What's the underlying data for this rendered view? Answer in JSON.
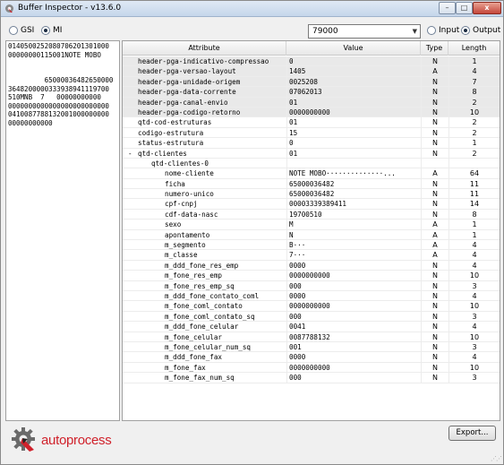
{
  "window": {
    "title": "Buffer Inspector - v13.6.0",
    "min_label": "–",
    "max_label": "□",
    "close_label": "x"
  },
  "toolbar": {
    "gsi_label": "GSI",
    "mi_label": "MI",
    "selected_mode": "MI",
    "combo_value": "79000",
    "input_label": "Input",
    "output_label": "Output",
    "selected_io": "Output"
  },
  "raw_buffer": "0140500252080706201301000\n00000000115001NOTE MOBO\n\n\n         65000036482650000\n3648200000333938941119700\n510MNB  7   00000000000\n0000000000000000000000000\n0410087788132001000000000\n00000000000",
  "grid": {
    "columns": [
      "Attribute",
      "Value",
      "Type",
      "Length"
    ],
    "rows": [
      {
        "attr": "header-pga-indicativo-compressao",
        "value": "0",
        "type": "N",
        "length": "1",
        "indent": 0,
        "hl": true
      },
      {
        "attr": "header-pga-versao-layout",
        "value": "1405",
        "type": "A",
        "length": "4",
        "indent": 0,
        "hl": true
      },
      {
        "attr": "header-pga-unidade-origem",
        "value": "0025208",
        "type": "N",
        "length": "7",
        "indent": 0,
        "hl": true
      },
      {
        "attr": "header-pga-data-corrente",
        "value": "07062013",
        "type": "N",
        "length": "8",
        "indent": 0,
        "hl": true
      },
      {
        "attr": "header-pga-canal-envio",
        "value": "01",
        "type": "N",
        "length": "2",
        "indent": 0,
        "hl": true
      },
      {
        "attr": "header-pga-codigo-retorno",
        "value": "0000000000",
        "type": "N",
        "length": "10",
        "indent": 0,
        "hl": true
      },
      {
        "attr": "qtd-cod-estruturas",
        "value": "01",
        "type": "N",
        "length": "2",
        "indent": 0,
        "hl": false
      },
      {
        "attr": "codigo-estrutura",
        "value": "15",
        "type": "N",
        "length": "2",
        "indent": 0,
        "hl": false
      },
      {
        "attr": "status-estrutura",
        "value": "0",
        "type": "N",
        "length": "1",
        "indent": 0,
        "hl": false
      },
      {
        "attr": "- qtd-clientes",
        "value": "01",
        "type": "N",
        "length": "2",
        "indent": 0,
        "hl": false
      },
      {
        "attr": "qtd-clientes-0",
        "value": "",
        "type": "",
        "length": "",
        "indent": 1,
        "hl": false
      },
      {
        "attr": "nome-cliente",
        "value": "NOTE MOBO··············...",
        "type": "A",
        "length": "64",
        "indent": 2,
        "hl": false
      },
      {
        "attr": "ficha",
        "value": "65000036482",
        "type": "N",
        "length": "11",
        "indent": 2,
        "hl": false
      },
      {
        "attr": "numero-unico",
        "value": "65000036482",
        "type": "N",
        "length": "11",
        "indent": 2,
        "hl": false
      },
      {
        "attr": "cpf-cnpj",
        "value": "00003339389411",
        "type": "N",
        "length": "14",
        "indent": 2,
        "hl": false
      },
      {
        "attr": "cdf-data-nasc",
        "value": "19700510",
        "type": "N",
        "length": "8",
        "indent": 2,
        "hl": false
      },
      {
        "attr": "sexo",
        "value": "M",
        "type": "A",
        "length": "1",
        "indent": 2,
        "hl": false
      },
      {
        "attr": "apontamento",
        "value": "N",
        "type": "A",
        "length": "1",
        "indent": 2,
        "hl": false
      },
      {
        "attr": "m_segmento",
        "value": "B···",
        "type": "A",
        "length": "4",
        "indent": 2,
        "hl": false
      },
      {
        "attr": "m_classe",
        "value": "7···",
        "type": "A",
        "length": "4",
        "indent": 2,
        "hl": false
      },
      {
        "attr": "m_ddd_fone_res_emp",
        "value": "0000",
        "type": "N",
        "length": "4",
        "indent": 2,
        "hl": false
      },
      {
        "attr": "m_fone_res_emp",
        "value": "0000000000",
        "type": "N",
        "length": "10",
        "indent": 2,
        "hl": false
      },
      {
        "attr": "m_fone_res_emp_sq",
        "value": "000",
        "type": "N",
        "length": "3",
        "indent": 2,
        "hl": false
      },
      {
        "attr": "m_ddd_fone_contato_coml",
        "value": "0000",
        "type": "N",
        "length": "4",
        "indent": 2,
        "hl": false
      },
      {
        "attr": "m_fone_coml_contato",
        "value": "0000000000",
        "type": "N",
        "length": "10",
        "indent": 2,
        "hl": false
      },
      {
        "attr": "m_fone_coml_contato_sq",
        "value": "000",
        "type": "N",
        "length": "3",
        "indent": 2,
        "hl": false
      },
      {
        "attr": "m_ddd_fone_celular",
        "value": "0041",
        "type": "N",
        "length": "4",
        "indent": 2,
        "hl": false
      },
      {
        "attr": "m_fone_celular",
        "value": "0087788132",
        "type": "N",
        "length": "10",
        "indent": 2,
        "hl": false
      },
      {
        "attr": "m_fone_celular_num_sq",
        "value": "001",
        "type": "N",
        "length": "3",
        "indent": 2,
        "hl": false
      },
      {
        "attr": "m_ddd_fone_fax",
        "value": "0000",
        "type": "N",
        "length": "4",
        "indent": 2,
        "hl": false
      },
      {
        "attr": "m_fone_fax",
        "value": "0000000000",
        "type": "N",
        "length": "10",
        "indent": 2,
        "hl": false
      },
      {
        "attr": "m_fone_fax_num_sq",
        "value": "000",
        "type": "N",
        "length": "3",
        "indent": 2,
        "hl": false
      }
    ]
  },
  "footer": {
    "brand": "autoprocess",
    "export_label": "Export..."
  },
  "colors": {
    "brand_red": "#d0212b",
    "header_row_bg": "#e9e9e9"
  }
}
